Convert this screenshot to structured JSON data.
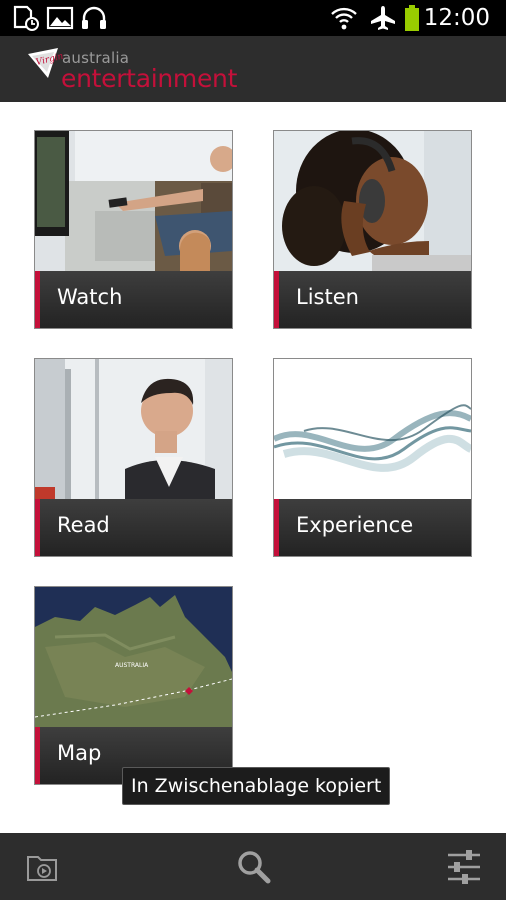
{
  "status_bar": {
    "time": "12:00",
    "icons": [
      "sd-card-icon",
      "image-icon",
      "headphones-icon",
      "wifi-icon",
      "airplane-icon",
      "battery-icon"
    ]
  },
  "app_header": {
    "brand_small": "australia",
    "brand_main": "entertainment",
    "logo": "Virgin",
    "accent_color": "#c4103a"
  },
  "tiles": [
    {
      "label": "Watch"
    },
    {
      "label": "Listen"
    },
    {
      "label": "Read"
    },
    {
      "label": "Experience"
    },
    {
      "label": "Map"
    }
  ],
  "map_tile": {
    "region_label": "AUSTRALIA"
  },
  "toast": {
    "text": "In Zwischenablage kopiert"
  },
  "bottom_bar": {
    "icons": [
      "video-folder-icon",
      "search-icon",
      "settings-sliders-icon"
    ]
  }
}
